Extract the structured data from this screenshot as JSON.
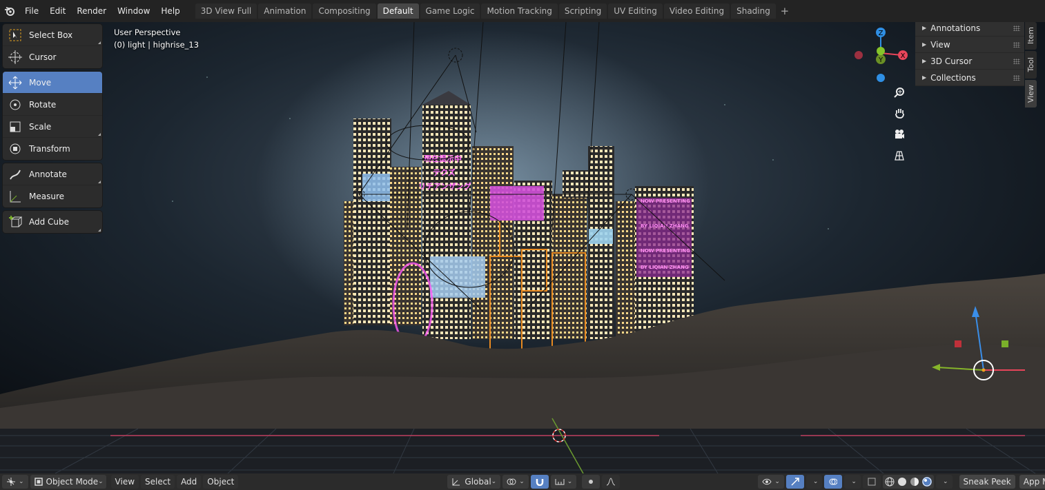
{
  "menu": [
    "File",
    "Edit",
    "Render",
    "Window",
    "Help"
  ],
  "workspace_tabs": [
    {
      "label": "3D View Full",
      "active": false
    },
    {
      "label": "Animation",
      "active": false
    },
    {
      "label": "Compositing",
      "active": false
    },
    {
      "label": "Default",
      "active": true
    },
    {
      "label": "Game Logic",
      "active": false
    },
    {
      "label": "Motion Tracking",
      "active": false
    },
    {
      "label": "Scripting",
      "active": false
    },
    {
      "label": "UV Editing",
      "active": false
    },
    {
      "label": "Video Editing",
      "active": false
    },
    {
      "label": "Shading",
      "active": false
    }
  ],
  "tools": {
    "select_box": "Select Box",
    "cursor": "Cursor",
    "move": "Move",
    "rotate": "Rotate",
    "scale": "Scale",
    "transform": "Transform",
    "annotate": "Annotate",
    "measure": "Measure",
    "add_cube": "Add Cube"
  },
  "viewport": {
    "perspective": "User Perspective",
    "object_info": "(0) light | highrise_13"
  },
  "gizmo": {
    "x": "X",
    "y": "Y",
    "z": "Z"
  },
  "sidebar_panels": [
    "Annotations",
    "View",
    "3D Cursor",
    "Collections"
  ],
  "sidebar_tabs": [
    "Item",
    "Tool",
    "View"
  ],
  "header": {
    "mode": "Object Mode",
    "view": "View",
    "select": "Select",
    "add": "Add",
    "object": "Object",
    "orientation": "Global",
    "sneak_peek": "Sneak Peek",
    "app_manager": "App Manager"
  },
  "billboards": {
    "jp1": "現在提示中",
    "jp2": "テクズ",
    "jp3": "リチアンザング",
    "now": "NOW PRESENTING",
    "by": "BY LIQIAN ZHANG"
  },
  "colors": {
    "accent_blue": "#5680c2",
    "axis_x": "#e8455a",
    "axis_y": "#86b52a",
    "axis_z": "#2f8fe4",
    "selection_orange": "#e88a20",
    "neon_pink": "#e040e0"
  }
}
